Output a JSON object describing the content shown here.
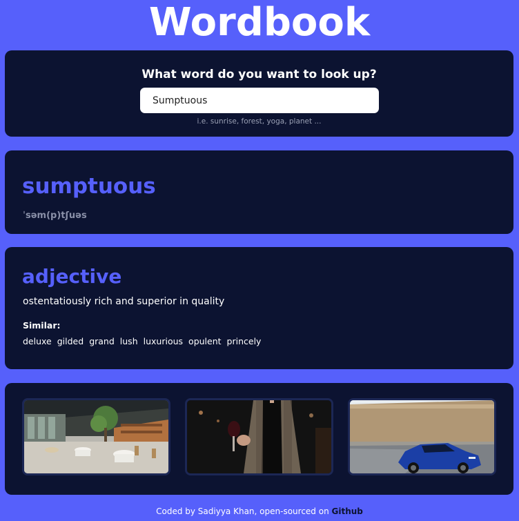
{
  "app": {
    "title": "Wordbook"
  },
  "search": {
    "question": "What word do you want to look up?",
    "value": "Sumptuous",
    "hint": "i.e. sunrise, forest, yoga, planet ..."
  },
  "word": {
    "text": "sumptuous",
    "phonetic": "ˈsəm(p)tʃuəs"
  },
  "meaning": {
    "part_of_speech": "adjective",
    "definition": "ostentatiously rich and superior in quality",
    "similar_label": "Similar:",
    "synonyms": [
      "deluxe",
      "gilded",
      "grand",
      "lush",
      "luxurious",
      "opulent",
      "princely"
    ]
  },
  "photos": {
    "items": [
      {
        "subject": "restaurant-interior"
      },
      {
        "subject": "person-with-wine-glass"
      },
      {
        "subject": "blue-sports-car"
      }
    ]
  },
  "footer": {
    "text": "Coded by Sadiyya Khan, open-sourced on",
    "link_label": "Github"
  },
  "colors": {
    "background": "#5660fb",
    "card": "#0c1331",
    "accent": "#5660fb"
  }
}
